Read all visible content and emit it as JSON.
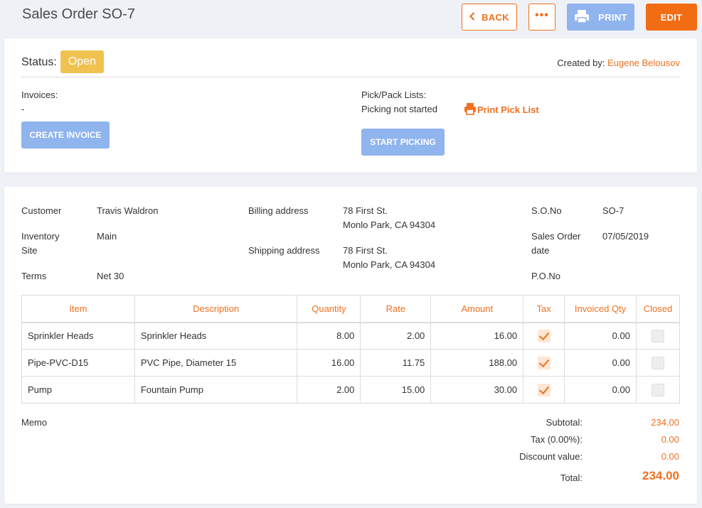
{
  "header": {
    "title": "Sales Order SO-7",
    "back_label": "BACK",
    "more_label": "•••",
    "print_label": "PRINT",
    "edit_label": "EDIT"
  },
  "status_card": {
    "status_label": "Status:",
    "status_value": "Open",
    "created_by_label": "Created by:",
    "created_by_name": "Eugene Belousov",
    "invoices_label": "Invoices:",
    "invoices_value": "-",
    "create_invoice_label": "CREATE INVOICE",
    "pick_pack_label": "Pick/Pack Lists:",
    "pick_pack_status": "Picking not started",
    "print_pick_list_label": "Print Pick List",
    "start_picking_label": "START PICKING"
  },
  "order_info": {
    "customer_label": "Customer",
    "customer_value": "Travis Waldron",
    "inventory_site_label_1": "Inventory",
    "inventory_site_label_2": "Site",
    "inventory_site_value": "Main",
    "terms_label": "Terms",
    "terms_value": "Net 30",
    "billing_label": "Billing address",
    "billing_line1": "78 First St.",
    "billing_line2": "Monlo Park, CA 94304",
    "shipping_label": "Shipping address",
    "shipping_line1": "78 First St.",
    "shipping_line2": "Monlo Park, CA 94304",
    "so_no_label": "S.O.No",
    "so_no_value": "SO-7",
    "so_date_label_1": "Sales Order",
    "so_date_label_2": "date",
    "so_date_value": "07/05/2019",
    "po_no_label": "P.O.No"
  },
  "table": {
    "headers": [
      "Item",
      "Description",
      "Quantity",
      "Rate",
      "Amount",
      "Tax",
      "Invoiced Qty",
      "Closed"
    ],
    "rows": [
      {
        "item": "Sprinkler Heads",
        "description": "Sprinkler Heads",
        "quantity": "8.00",
        "rate": "2.00",
        "amount": "16.00",
        "tax": true,
        "invoiced_qty": "0.00",
        "closed": false
      },
      {
        "item": "Pipe-PVC-D15",
        "description": "PVC Pipe, Diameter 15",
        "quantity": "16.00",
        "rate": "11.75",
        "amount": "188.00",
        "tax": true,
        "invoiced_qty": "0.00",
        "closed": false
      },
      {
        "item": "Pump",
        "description": "Fountain Pump",
        "quantity": "2.00",
        "rate": "15.00",
        "amount": "30.00",
        "tax": true,
        "invoiced_qty": "0.00",
        "closed": false
      }
    ]
  },
  "summary": {
    "memo_label": "Memo",
    "subtotal_label": "Subtotal:",
    "subtotal_value": "234.00",
    "tax_label": "Tax (0.00%):",
    "tax_value": "0.00",
    "discount_label": "Discount value:",
    "discount_value": "0.00",
    "total_label": "Total:",
    "total_value": "234.00"
  },
  "colors": {
    "accent": "#f07020",
    "button_blue": "#8fb4ee",
    "status_yellow": "#f0c24f",
    "page_bg": "#eef1f5"
  },
  "icons": {
    "back": "chevron-left-icon",
    "print": "printer-icon",
    "pick_list": "printer-icon"
  }
}
